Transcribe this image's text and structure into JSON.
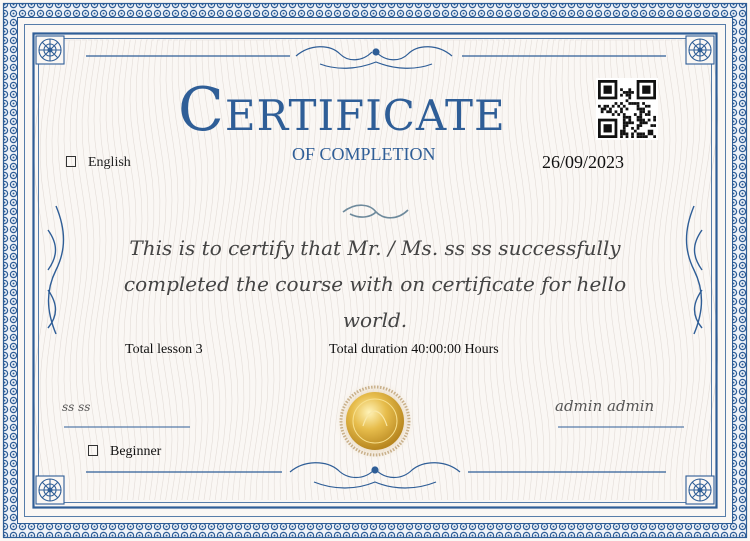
{
  "certificate": {
    "title": "Certificate",
    "subtitle": "OF COMPLETION",
    "language": "English",
    "date": "26/09/2023",
    "statement": "This is to certify that Mr. / Ms. ss ss successfully completed the course with on certificate for hello world.",
    "total_lesson": "Total lesson 3",
    "total_duration": "Total duration 40:00:00 Hours",
    "signature_left": "ss ss",
    "signature_right": "admin admin",
    "level": "Beginner"
  },
  "icons": {
    "language": "globe-icon",
    "level": "level-icon",
    "qr": "qr-code-icon",
    "seal": "gold-seal-icon"
  },
  "colors": {
    "border_blue": "#2f5e97",
    "paper": "#faf7f4",
    "seal_gold": "#d8a93a"
  }
}
